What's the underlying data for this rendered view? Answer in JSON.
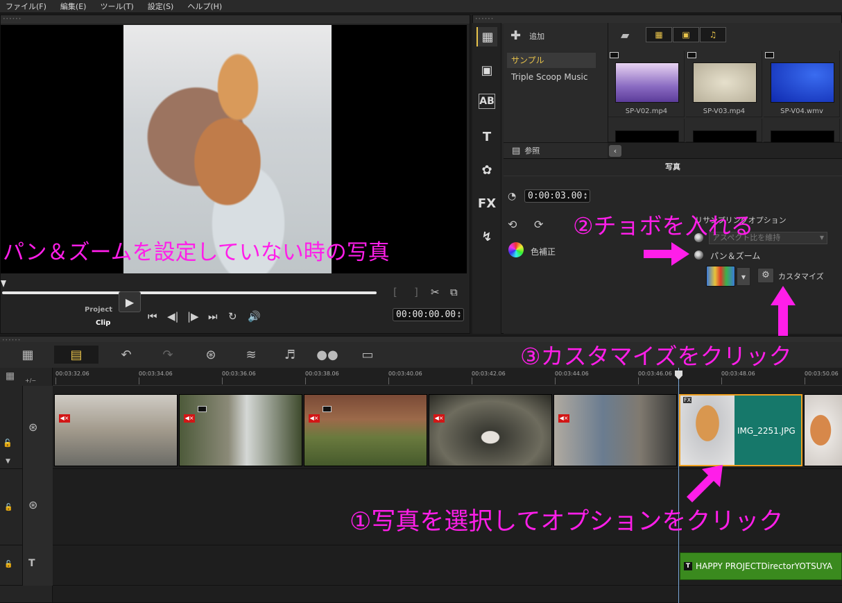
{
  "menu": [
    "ファイル(F)",
    "編集(E)",
    "ツール(T)",
    "設定(S)",
    "ヘルプ(H)"
  ],
  "preview": {
    "project_label": "Project",
    "clip_label": "Clip",
    "timecode": "00:00:00.00"
  },
  "library": {
    "add_label": "追加",
    "browse_label": "参照",
    "folders": [
      "サンプル",
      "Triple Scoop Music"
    ],
    "thumbnails": [
      {
        "name": "SP-V02.mp4",
        "color": "#a07ec9"
      },
      {
        "name": "SP-V03.mp4",
        "color": "#d8d0b8"
      },
      {
        "name": "SP-V04.wmv",
        "color": "#1a3fd2"
      }
    ]
  },
  "options": {
    "tab_title": "写真",
    "duration": "0:00:03.00",
    "color_correction": "色補正",
    "resampling_option": "リサンプリングオプション",
    "aspect_keep": "アスペクト比を維持",
    "pan_zoom": "パン＆ズーム",
    "customize": "カスタマイズ"
  },
  "timeline": {
    "zoom_label": "+/−",
    "ruler_ticks": [
      "00:03:32.06",
      "00:03:34.06",
      "00:03:36.06",
      "00:03:38.06",
      "00:03:40.06",
      "00:03:42.06",
      "00:03:44.06",
      "00:03:46.06",
      "00:03:48.06",
      "00:03:50.06"
    ],
    "photo_clip_label": "IMG_2251.JPG",
    "fx_badge": "FX",
    "title_clip_badge": "T",
    "title_clip_text": "HAPPY PROJECTDirectorYOTSUYA"
  },
  "annotations": {
    "left_note": "パン＆ズームを設定していない時の写真",
    "step1": "①写真を選択してオプションをクリック",
    "step2": "②チョボを入れる",
    "step3": "③カスタマイズをクリック"
  },
  "colors": {
    "annotation": "#ff1ee9",
    "accent": "#e8c34a",
    "title_track": "#3a8a1e"
  }
}
